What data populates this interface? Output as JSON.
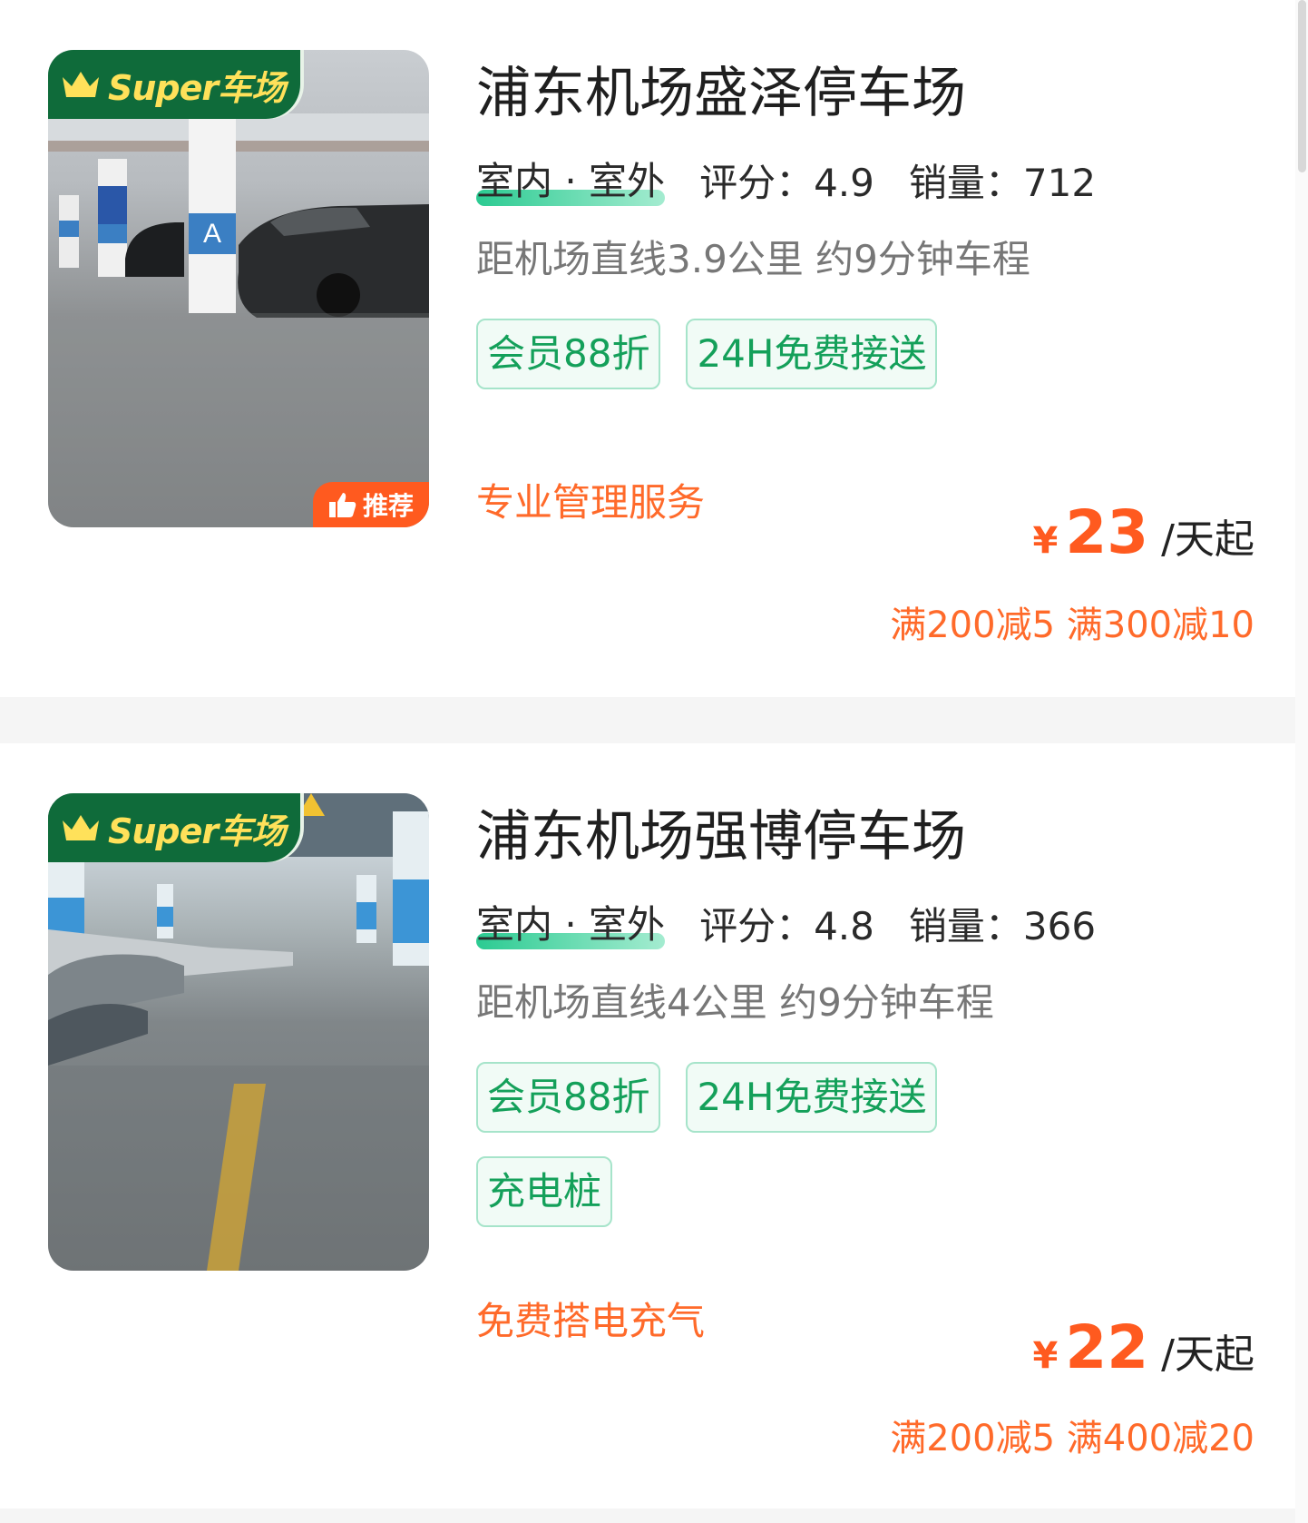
{
  "listings": [
    {
      "badge": "Super车场",
      "recommend": "推荐",
      "title": "浦东机场盛泽停车场",
      "type": "室内 · 室外",
      "rating_label": "评分：",
      "rating": "4.9",
      "sales_label": "销量：",
      "sales": "712",
      "distance": "距机场直线3.9公里 约9分钟车程",
      "tags": [
        "会员88折",
        "24H免费接送"
      ],
      "slogan": "专业管理服务",
      "price_symbol": "¥",
      "price": "23",
      "price_unit": "/天起",
      "discounts": "满200减5 满300减10"
    },
    {
      "badge": "Super车场",
      "title": "浦东机场强博停车场",
      "type": "室内 · 室外",
      "rating_label": "评分：",
      "rating": "4.8",
      "sales_label": "销量：",
      "sales": "366",
      "distance": "距机场直线4公里 约9分钟车程",
      "tags": [
        "会员88折",
        "24H免费接送",
        "充电桩"
      ],
      "slogan": "免费搭电充气",
      "price_symbol": "¥",
      "price": "22",
      "price_unit": "/天起",
      "discounts": "满200减5 满400减20"
    }
  ],
  "colors": {
    "brand_green": "#0f6b3a",
    "badge_text_yellow": "#ffe15a",
    "tag_green": "#14a05a",
    "price_orange": "#ff5a1f",
    "slogan_orange": "#ff6a2a"
  }
}
